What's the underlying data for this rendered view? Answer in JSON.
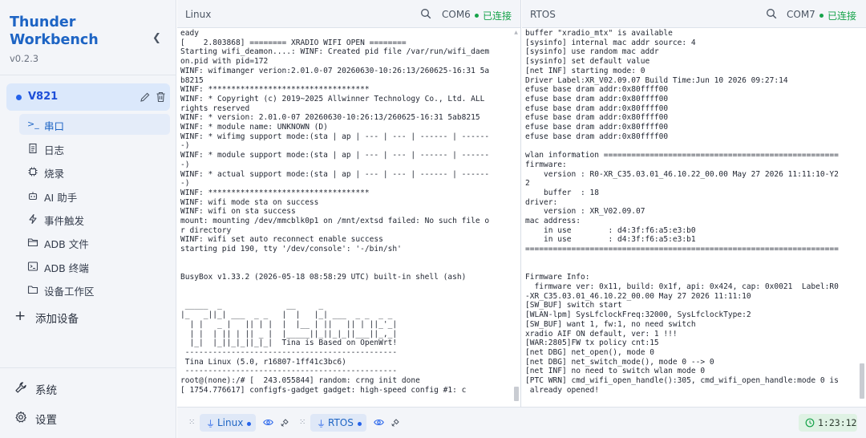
{
  "app": {
    "title_line1": "Thunder",
    "title_line2": "Workbench",
    "version": "v0.2.3",
    "brand_color": "#1d64c4"
  },
  "sidebar": {
    "device": {
      "name": "V821",
      "edit_icon": "pencil-icon",
      "delete_icon": "trash-icon"
    },
    "items": [
      {
        "label": "串口",
        "icon": "terminal-icon",
        "active": true
      },
      {
        "label": "日志",
        "icon": "document-icon",
        "active": false
      },
      {
        "label": "烧录",
        "icon": "chip-icon",
        "active": false
      },
      {
        "label": "AI 助手",
        "icon": "robot-icon",
        "active": false
      },
      {
        "label": "事件触发",
        "icon": "lightning-icon",
        "active": false
      },
      {
        "label": "ADB 文件",
        "icon": "folder-icon",
        "active": false
      },
      {
        "label": "ADB 终端",
        "icon": "terminal-window-icon",
        "active": false
      },
      {
        "label": "设备工作区",
        "icon": "folder-icon",
        "active": false
      }
    ],
    "add_device": "添加设备",
    "bottom": [
      {
        "label": "系统",
        "icon": "wrench-icon"
      },
      {
        "label": "设置",
        "icon": "gear-icon"
      }
    ]
  },
  "panes": [
    {
      "title": "Linux",
      "port": "COM6",
      "status": "已连接",
      "status_color": "#16a34a",
      "lines": [
        "eady",
        "[    2.803868] ======== XRADIO WIFI OPEN ========",
        "Starting wifi_deamon....: WINF: Created pid file /var/run/wifi_daem",
        "on.pid with pid=172",
        "WINF: wifimanger verion:2.01.0-07 20260630-10:26:13/260625-16:31 5a",
        "b8215",
        "WINF: ***********************************",
        "WINF: * Copyright (c) 2019~2025 Allwinner Technology Co., Ltd. ALL",
        "rights reserved",
        "WINF: * version: 2.01.0-07 20260630-10:26:13/260625-16:31 5ab8215",
        "WINF: * module name: UNKNOWN (D)",
        "WINF: * wifimg support mode:(sta | ap | --- | --- | ------ | ------",
        "-)",
        "WINF: * module support mode:(sta | ap | --- | --- | ------ | ------",
        "-)",
        "WINF: * actual support mode:(sta | ap | --- | --- | ------ | ------",
        "-)",
        "WINF: ***********************************",
        "WINF: wifi mode sta on success",
        "WINF: wifi on sta success",
        "mount: mounting /dev/mmcblk0p1 on /mnt/extsd failed: No such file o",
        "r directory",
        "WINF: wifi set auto reconnect enable success",
        "starting pid 190, tty '/dev/console': '-/bin/sh'",
        "",
        "",
        "BusyBox v1.33.2 (2026-05-18 08:58:29 UTC) built-in shell (ash)",
        "",
        "",
        " _____  _              __     _",
        "|_   _||_| ___  _ _   |  |   |_| ___  _ _  _ _",
        "  | |   _ |   || | |  |  |__ | ||   || | ||_'_|",
        "  | |  | || | || _ |  |_____||_||_|_||___||_,_|",
        "  |_|  |_||_|_||_|_|  Tina is Based on OpenWrt!",
        " ----------------------------------------------",
        " Tina Linux (5.0, r16807-1ff41c3bc6)",
        " ----------------------------------------------",
        "root@(none):/# [  243.055844] random: crng init done",
        "[ 1754.776617] configfs-gadget gadget: high-speed config #1: c"
      ]
    },
    {
      "title": "RTOS",
      "port": "COM7",
      "status": "已连接",
      "status_color": "#16a34a",
      "lines": [
        "buffer \"xradio_mtx\" is available",
        "[sysinfo] internal mac addr source: 4",
        "[sysinfo] use random mac addr",
        "[sysinfo] set default value",
        "[net INF] starting mode: 0",
        "Driver Label:XR_V02.09.07 Build Time:Jun 10 2026 09:27:14",
        "efuse base dram addr:0x80ffff00",
        "efuse base dram addr:0x80ffff00",
        "efuse base dram addr:0x80ffff00",
        "efuse base dram addr:0x80ffff00",
        "efuse base dram addr:0x80ffff00",
        "efuse base dram addr:0x80ffff00",
        "",
        "wlan information ===================================================",
        "firmware:",
        "    version : R0-XR_C35.03.01_46.10.22_00.00 May 27 2026 11:11:10-Y2",
        "2",
        "    buffer  : 18",
        "driver:",
        "    version : XR_V02.09.07",
        "mac address:",
        "    in use        : d4:3f:f6:a5:e3:b0",
        "    in use        : d4:3f:f6:a5:e3:b1",
        "====================================================================",
        "",
        "",
        "Firmware Info:",
        "  firmware ver: 0x11, build: 0x1f, api: 0x424, cap: 0x0021  Label:R0",
        "-XR_C35.03.01_46.10.22_00.00 May 27 2026 11:11:10",
        "[SW_BUF] switch start",
        "[WLAN-lpm] SysLfclockFreq:32000, SysLfclockType:2",
        "[SW_BUF] want 1, fw:1, no need switch",
        "xradio AIF ON default, ver: 1 !!!",
        "[WAR:2805]FW tx policy cnt:15",
        "[net DBG] net_open(), mode 0",
        "[net DBG] net_switch_mode(), mode 0 --> 0",
        "[net INF] no need to switch wlan mode 0",
        "[PTC WRN] cmd_wifi_open_handle():305, cmd_wifi_open_handle:mode 0 is",
        " already opened!"
      ]
    }
  ],
  "bottombar": {
    "tabs": [
      {
        "label": "Linux",
        "icon": "plug-icon"
      },
      {
        "label": "RTOS",
        "icon": "plug-icon"
      }
    ],
    "timer": "1:23:12",
    "timer_color": "#16a34a"
  }
}
